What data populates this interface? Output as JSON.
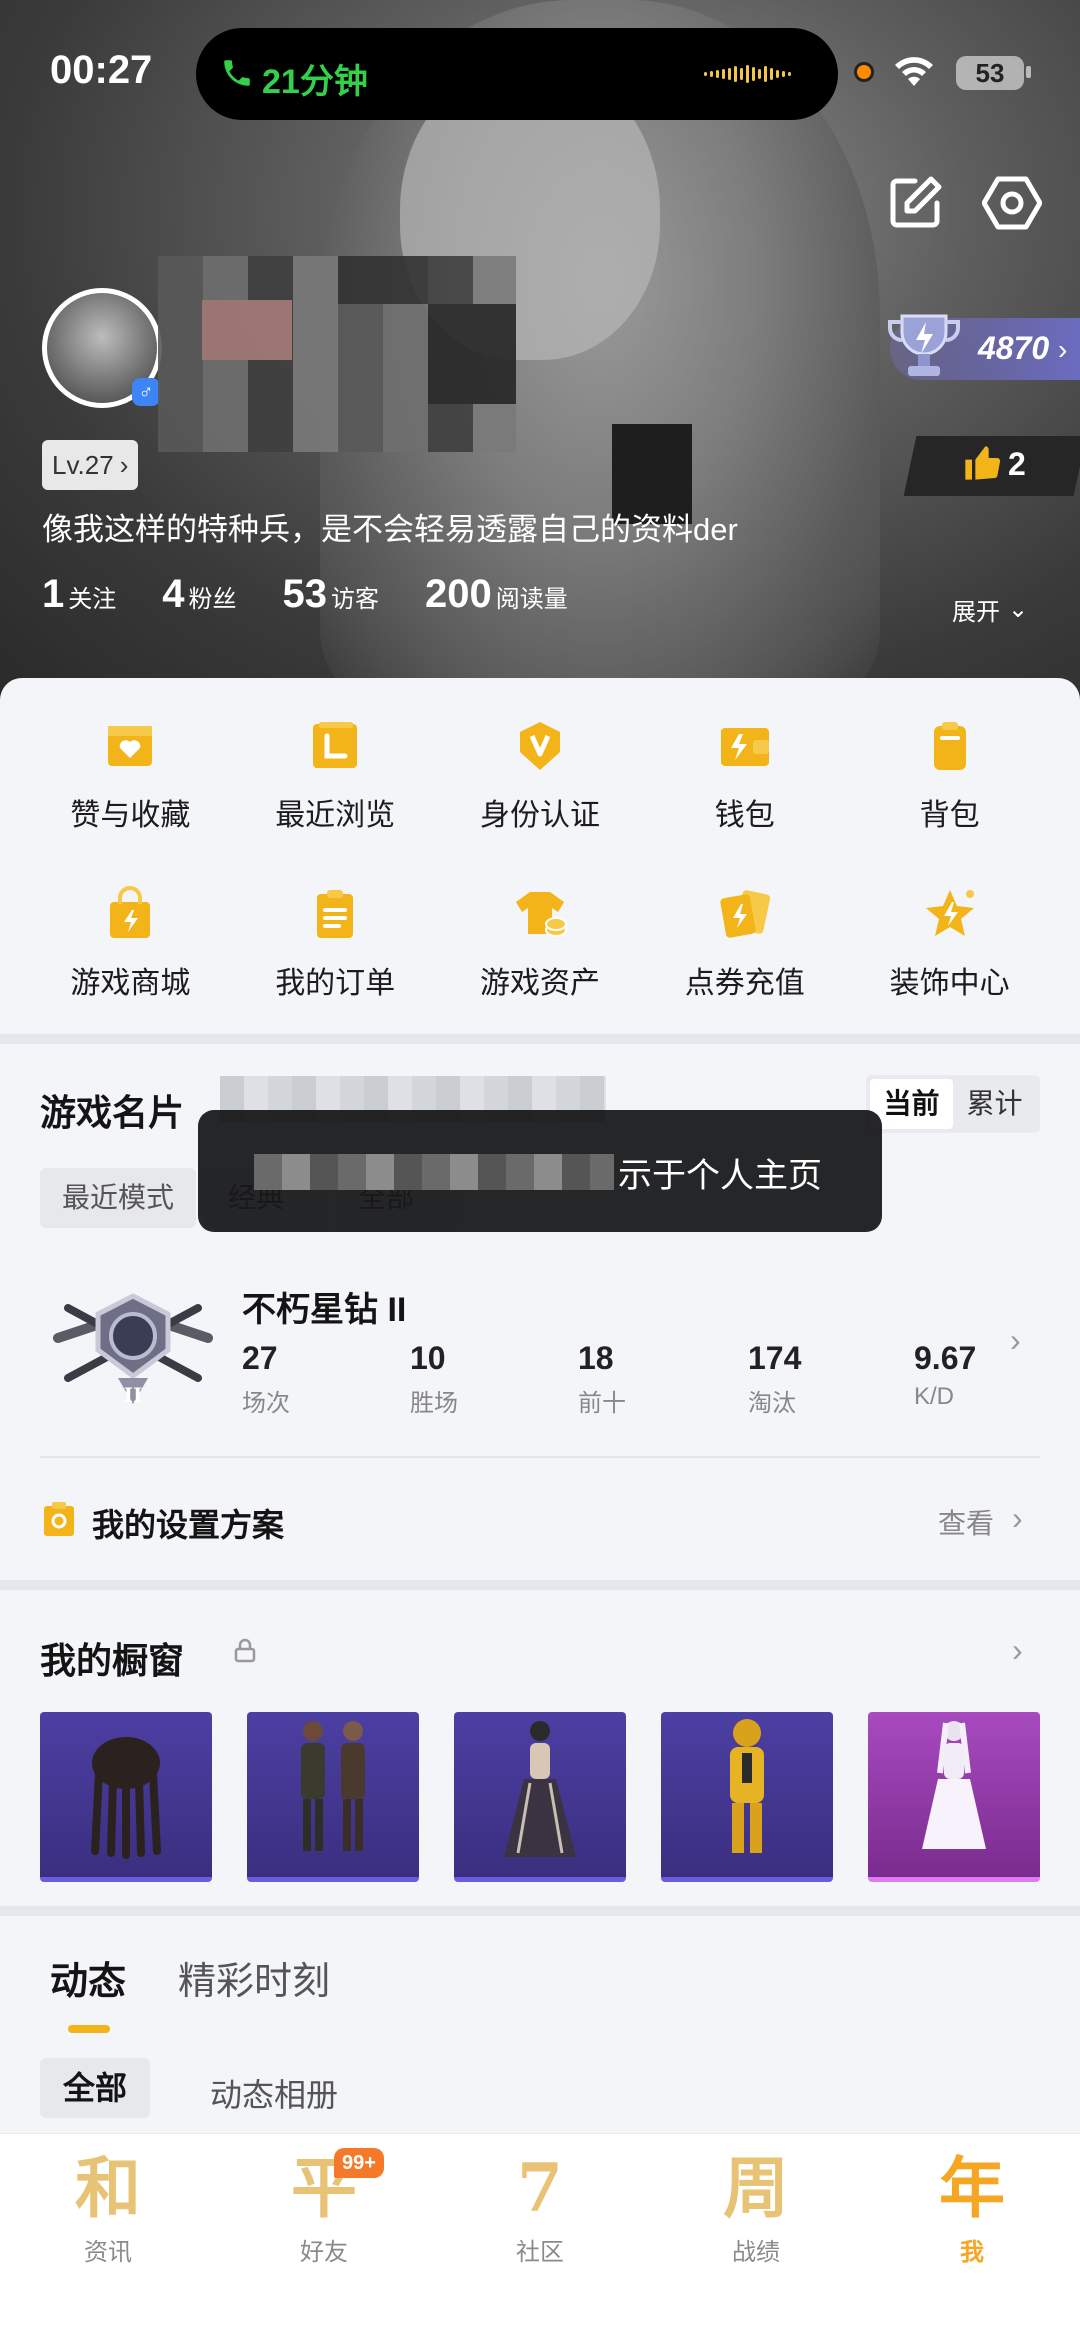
{
  "status_bar": {
    "time": "00:27",
    "call_label": "21分钟",
    "battery": "53"
  },
  "profile": {
    "level": "Lv.27",
    "bio": "像我这样的特种兵，是不会轻易透露自己的资料der",
    "stats": [
      {
        "value": "1",
        "label": "关注"
      },
      {
        "value": "4",
        "label": "粉丝"
      },
      {
        "value": "53",
        "label": "访客"
      },
      {
        "value": "200",
        "label": "阅读量"
      }
    ],
    "expand_label": "展开",
    "trophy_score": "4870",
    "likes": "2"
  },
  "shortcuts": {
    "row1": [
      {
        "label": "赞与收藏",
        "icon": "heart-folder-icon"
      },
      {
        "label": "最近浏览",
        "icon": "history-icon"
      },
      {
        "label": "身份认证",
        "icon": "verify-badge-icon"
      },
      {
        "label": "钱包",
        "icon": "wallet-icon"
      },
      {
        "label": "背包",
        "icon": "backpack-icon"
      }
    ],
    "row2": [
      {
        "label": "游戏商城",
        "icon": "shopping-bag-icon"
      },
      {
        "label": "我的订单",
        "icon": "order-list-icon"
      },
      {
        "label": "游戏资产",
        "icon": "tshirt-coin-icon"
      },
      {
        "label": "点券充值",
        "icon": "coupon-cards-icon"
      },
      {
        "label": "装饰中心",
        "icon": "star-decor-icon"
      }
    ]
  },
  "game_card": {
    "title": "游戏名片",
    "segment": [
      "当前",
      "累计"
    ],
    "filters": [
      "最近模式",
      "经典",
      "全部"
    ],
    "toast_tail": "示于个人主页",
    "rank_name": "不朽星钻 II",
    "stats": [
      {
        "value": "27",
        "label": "场次"
      },
      {
        "value": "10",
        "label": "胜场"
      },
      {
        "value": "18",
        "label": "前十"
      },
      {
        "value": "174",
        "label": "淘汰"
      },
      {
        "value": "9.67",
        "label": "K/D"
      }
    ],
    "settings_label": "我的设置方案",
    "settings_link": "查看"
  },
  "showcase": {
    "title": "我的橱窗"
  },
  "feed": {
    "tabs": [
      "动态",
      "精彩时刻"
    ],
    "filters": [
      "全部",
      "动态相册"
    ]
  },
  "bottom_nav": [
    {
      "glyph": "和",
      "label": "资讯"
    },
    {
      "glyph": "平",
      "label": "好友",
      "badge": "99+"
    },
    {
      "glyph": "7",
      "label": "社区"
    },
    {
      "glyph": "周",
      "label": "战绩"
    },
    {
      "glyph": "年",
      "label": "我"
    }
  ],
  "colors": {
    "accent": "#f5a623",
    "icon_yellow": "#f3b419",
    "call_green": "#35d04a"
  }
}
